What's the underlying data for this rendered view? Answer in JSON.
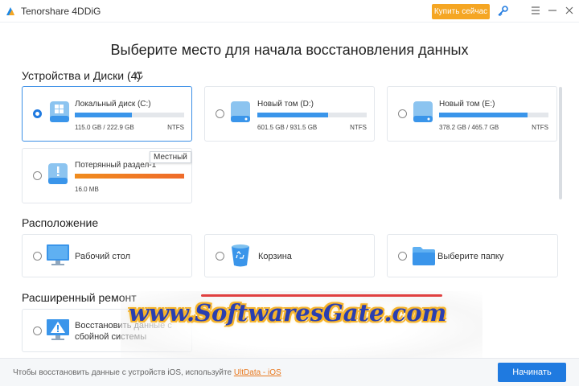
{
  "titlebar": {
    "app_name": "Tenorshare 4DDiG",
    "buy_label": "Купить сейчас",
    "icons": [
      "app-logo-icon",
      "key-icon",
      "menu-icon",
      "minimize-icon",
      "close-icon"
    ]
  },
  "main": {
    "title": "Выберите место для начала восстановления данных"
  },
  "devices": {
    "heading": "Устройства и Диски (4)",
    "tooltip": "Местный",
    "items": [
      {
        "name": "Локальный диск (C:)",
        "size": "115.0 GB / 222.9 GB",
        "fs": "NTFS",
        "usage": 0.52,
        "selected": true,
        "icon": "windows-drive-icon"
      },
      {
        "name": "Новый том (D:)",
        "size": "601.5 GB / 931.5 GB",
        "fs": "NTFS",
        "usage": 0.65,
        "selected": false,
        "icon": "drive-icon"
      },
      {
        "name": "Новый том (E:)",
        "size": "378.2 GB / 465.7 GB",
        "fs": "NTFS",
        "usage": 0.81,
        "selected": false,
        "icon": "drive-icon"
      },
      {
        "name": "Потерянный раздел-1",
        "size": "16.0 MB",
        "fs": "",
        "usage": 1.0,
        "selected": false,
        "icon": "lost-partition-icon"
      }
    ]
  },
  "location": {
    "heading": "Расположение",
    "items": [
      {
        "label": "Рабочий стол",
        "icon": "desktop-icon"
      },
      {
        "label": "Корзина",
        "icon": "recycle-bin-icon"
      },
      {
        "label": "Выберите папку",
        "icon": "folder-icon"
      }
    ]
  },
  "advanced": {
    "heading": "Расширенный ремонт",
    "items": [
      {
        "line1": "Восстановить данные с",
        "line2": "сбойной системы",
        "icon": "crashed-system-icon"
      }
    ]
  },
  "watermark": {
    "text": "www.SoftwaresGate.com"
  },
  "footer": {
    "text": "Чтобы восстановить данные с устройств iOS, используйте ",
    "link": "UltData - iOS",
    "start_label": "Начинать"
  },
  "colors": {
    "accent": "#1f7ae0",
    "buy": "#f5a623",
    "bar": "#3a95ea",
    "lost_bar": "#ef6b2a",
    "link": "#e8781e"
  }
}
